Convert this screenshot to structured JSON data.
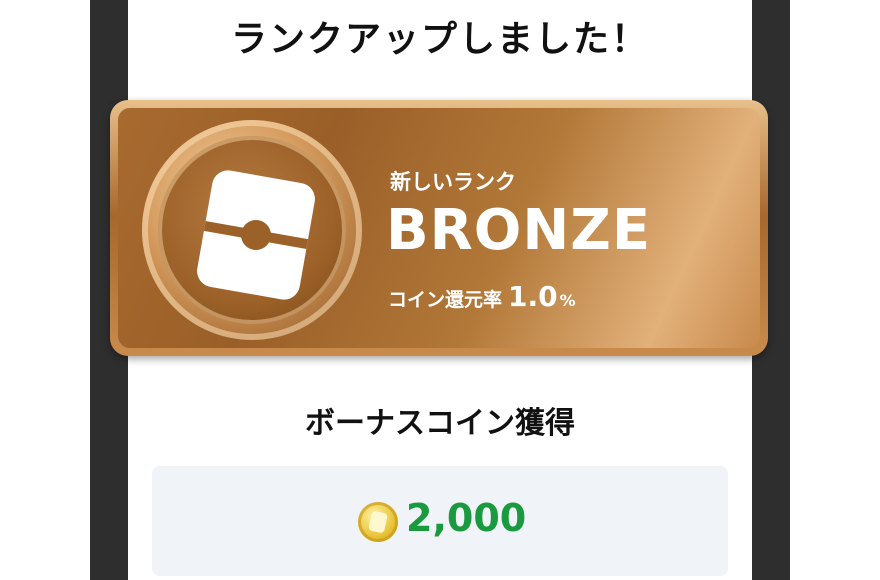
{
  "header": {
    "title": "ランクアップしました！"
  },
  "rank_card": {
    "label": "新しいランク",
    "rank_name": "BRONZE",
    "rate_label": "コイン還元率",
    "rate_value": "1.0",
    "rate_unit": "%"
  },
  "bonus": {
    "title": "ボーナスコイン獲得",
    "amount": "2,000"
  },
  "colors": {
    "bronze": "#a86a2f",
    "amount_green": "#1a9a3f",
    "box_bg": "#f0f3f7",
    "coin_gold": "#e9c63c"
  },
  "icons": {
    "medal": "bronze-medal-icon",
    "coin": "coin-icon"
  }
}
